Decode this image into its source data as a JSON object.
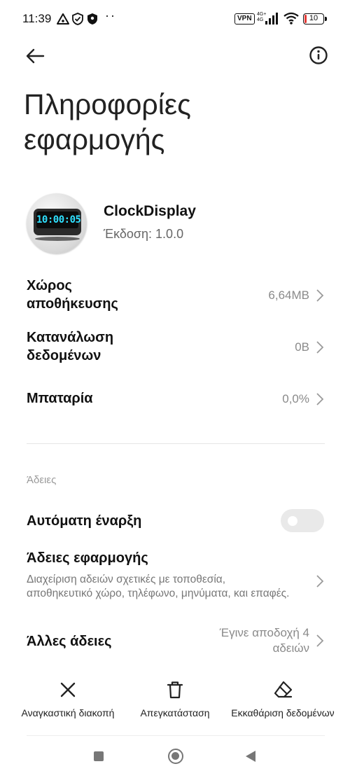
{
  "status_bar": {
    "time": "11:39",
    "icons": [
      "alert-triangle-icon",
      "shield-check-icon",
      "shield-icon",
      "more-dots-icon"
    ],
    "vpn": "VPN",
    "network": "4G+",
    "network_sub": "4G",
    "battery": "10",
    "battery_level": 0.1,
    "battery_color": "#e53935"
  },
  "top_bar": {
    "back_icon": "arrow-left-icon",
    "info_icon": "info-circle-icon"
  },
  "page_title": "Πληροφορίες εφαρμογής",
  "app": {
    "name": "ClockDisplay",
    "version": "Έκδοση: 1.0.0",
    "icon_clock_text": "10:00:05"
  },
  "storage": {
    "label": "Χώρος αποθήκευσης",
    "value": "6,64MB"
  },
  "data_usage": {
    "label": "Κατανάλωση δεδομένων",
    "value": "0B"
  },
  "battery_row": {
    "label": "Μπαταρία",
    "value": "0,0%"
  },
  "permissions_section": {
    "heading": "Άδειες",
    "autostart": {
      "label": "Αυτόματη έναρξη",
      "enabled": false
    },
    "app_permissions": {
      "label": "Άδειες εφαρμογής",
      "description": "Διαχείριση αδειών σχετικές με τοποθεσία, αποθηκευτικό χώρο, τηλέφωνο, μηνύματα, και επαφές."
    },
    "other_permissions": {
      "label": "Άλλες άδειες",
      "value": "Έγινε αποδοχή 4 αδειών"
    }
  },
  "actions": {
    "force_stop": "Αναγκαστική διακοπή",
    "uninstall": "Απεγκατάσταση",
    "clear_data": "Εκκαθάριση δεδομένων"
  },
  "nav_bar": {
    "recents_icon": "square-icon",
    "home_icon": "circle-icon",
    "back_icon": "triangle-back-icon"
  }
}
